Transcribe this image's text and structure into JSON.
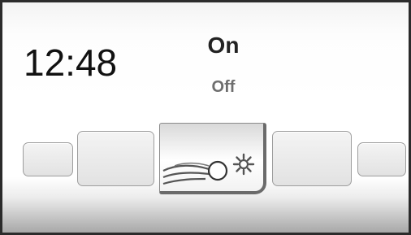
{
  "clock": {
    "time": "12:48"
  },
  "mode_selector": {
    "selected_label": "On",
    "unselected_label": "Off"
  },
  "carousel": {
    "tiles": [
      {
        "slot": "far-left",
        "state": "inactive"
      },
      {
        "slot": "left",
        "state": "inactive"
      },
      {
        "slot": "center",
        "state": "active",
        "icon": "steam-lamp-sun-icon"
      },
      {
        "slot": "right",
        "state": "inactive"
      },
      {
        "slot": "far-right",
        "state": "inactive"
      }
    ]
  },
  "colors": {
    "frame": "#2b2b2b",
    "selected_text": "#222222",
    "unselected_text": "#6e6e6e",
    "tile_border": "#9d9d9d"
  }
}
